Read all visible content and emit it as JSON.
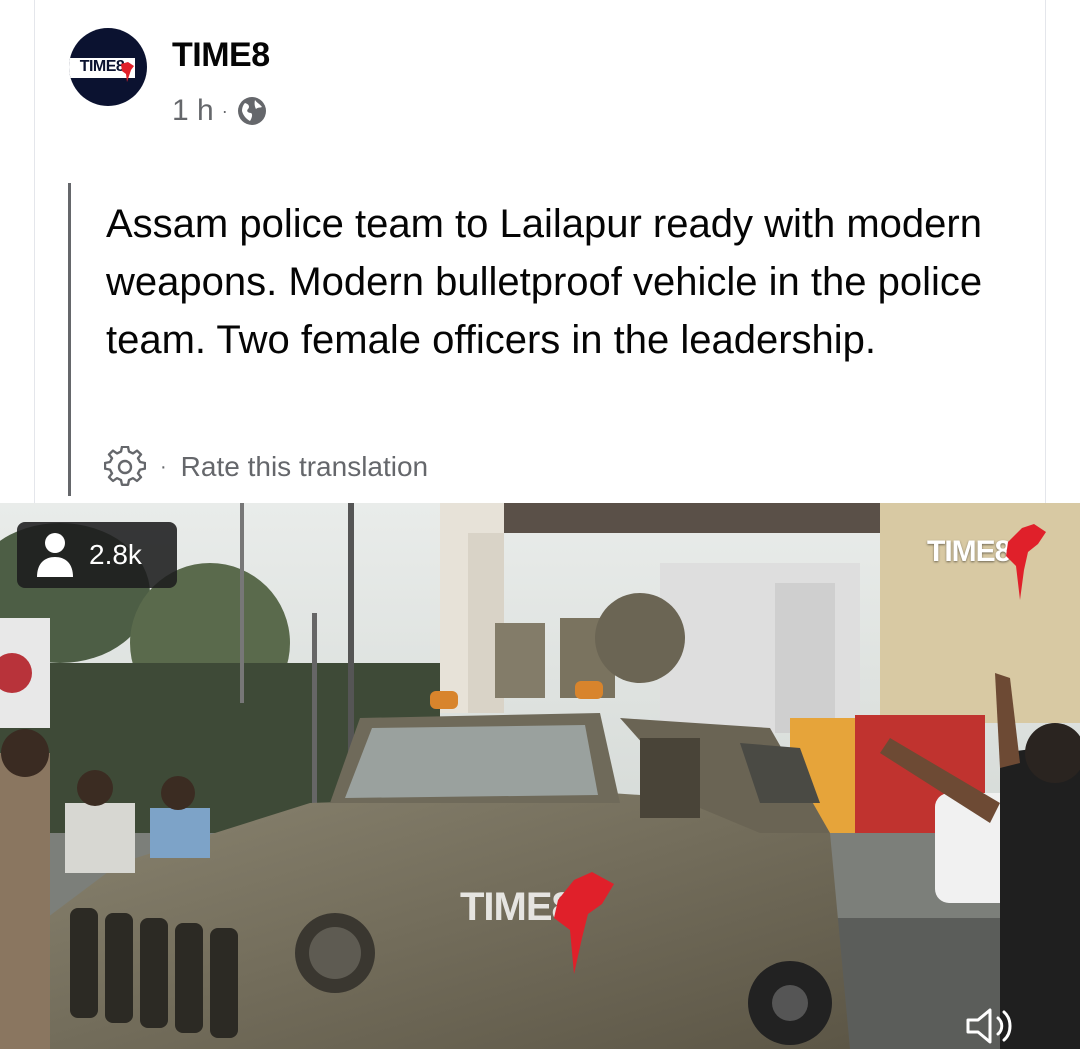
{
  "post": {
    "author": "TIME8",
    "avatar_logo": "TIME8",
    "time": "1 h",
    "meta_separator": "·",
    "privacy_icon": "globe-icon",
    "text": "Assam police team to Lailapur ready with modern weapons. Modern bulletproof vehicle in the police team. Two female officers in the leadership.",
    "translation_separator": "·",
    "rate_translation": "Rate this translation"
  },
  "video": {
    "views": "2.8k",
    "watermark_corner": "TIME8",
    "watermark_center": "TIME8",
    "volume_icon": "speaker-icon"
  },
  "colors": {
    "meta_gray": "#65676b",
    "text_dark": "#050505",
    "brand_navy": "#0b1230",
    "brand_red": "#e0202a"
  }
}
